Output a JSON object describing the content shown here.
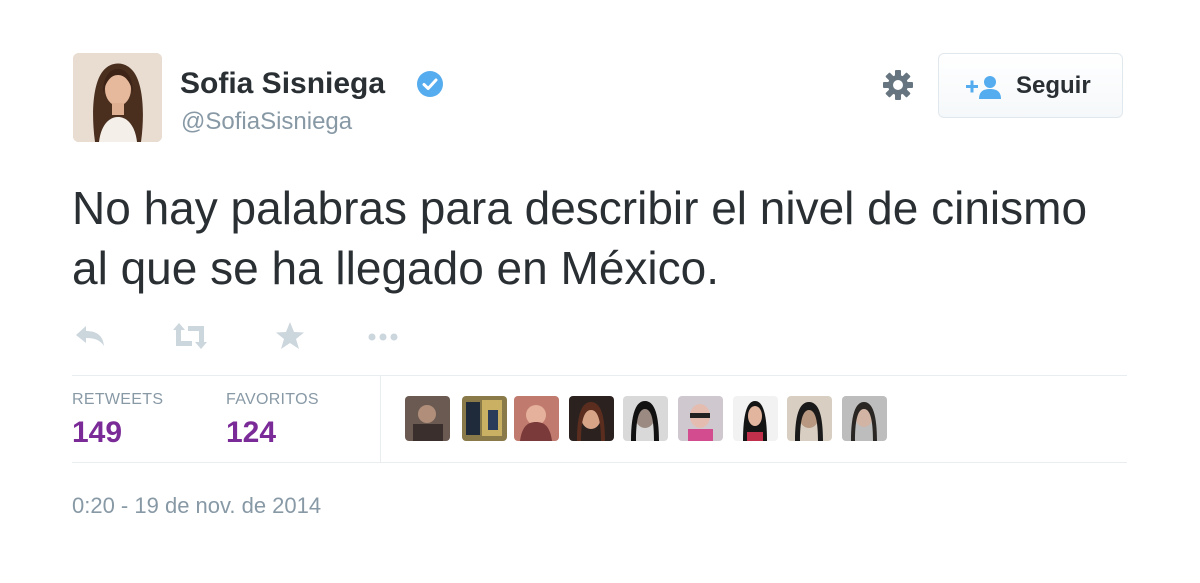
{
  "author": {
    "name": "Sofia Sisniega",
    "handle": "@SofiaSisniega"
  },
  "follow_button": {
    "label": "Seguir",
    "icon": "add-user-icon"
  },
  "tweet": {
    "text": "No hay palabras para describir el nivel de cinismo al que se ha llegado en México."
  },
  "actions": [
    {
      "icon": "reply-icon"
    },
    {
      "icon": "retweet-icon"
    },
    {
      "icon": "favorite-star-icon"
    },
    {
      "icon": "more-dots-icon"
    }
  ],
  "stats": {
    "retweets_label": "RETWEETS",
    "retweets_value": "149",
    "favorites_label": "FAVORITOS",
    "favorites_value": "124"
  },
  "timestamp": "0:20 - 19 de nov. de 2014",
  "colors": {
    "text": "#292f33",
    "muted": "#8899a6",
    "stat_value": "#7b2b98",
    "verified": "#55acee",
    "action_icon": "#ccd6dd"
  }
}
